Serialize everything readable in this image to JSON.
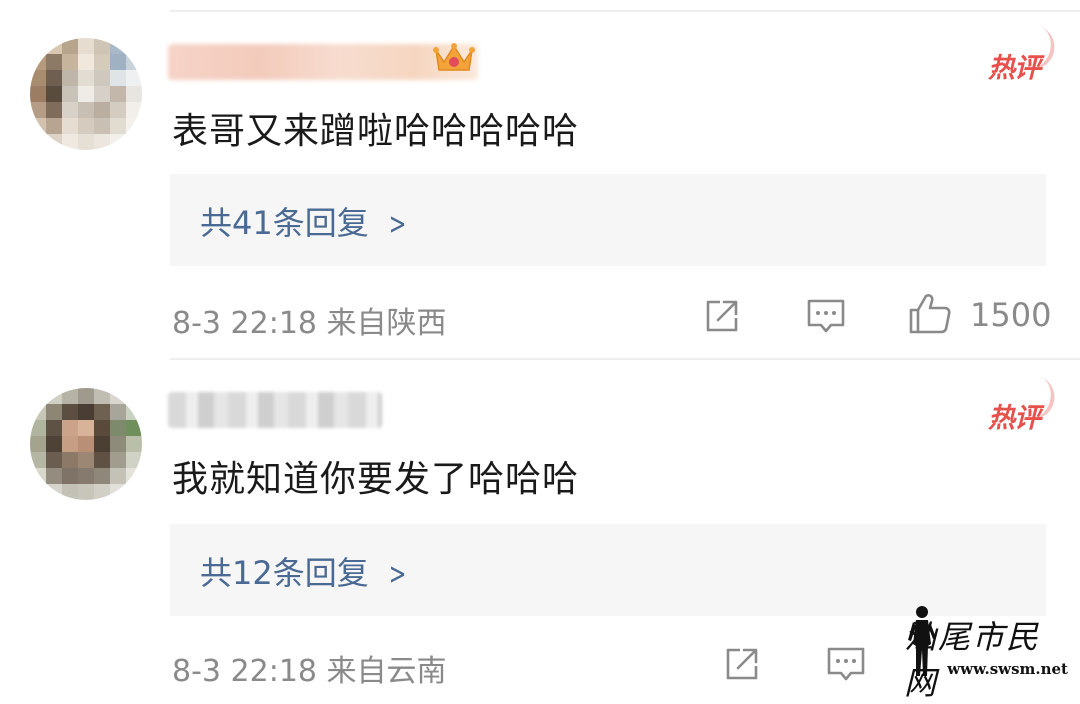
{
  "comments": [
    {
      "hot_badge": "热评",
      "text": "表哥又来蹭啦哈哈哈哈哈",
      "reply_link": "共41条回复",
      "meta": "8-3 22:18 来自陕西",
      "like_count": "1500"
    },
    {
      "hot_badge": "热评",
      "text": "我就知道你要发了哈哈哈",
      "reply_link": "共12条回复",
      "meta": "8-3 22:18 来自云南"
    }
  ],
  "icons": {
    "share": "share-icon",
    "comment": "comment-icon",
    "like": "thumbs-up-icon",
    "chevron": "chevron-right-icon"
  },
  "colors": {
    "hot_badge": "#e8504c",
    "reply_link": "#4a6a94",
    "meta": "#8a8a8a",
    "reply_box_bg": "#f6f6f6"
  },
  "watermark": {
    "title": "汕尾市民网",
    "url": "www.swsm.net"
  }
}
